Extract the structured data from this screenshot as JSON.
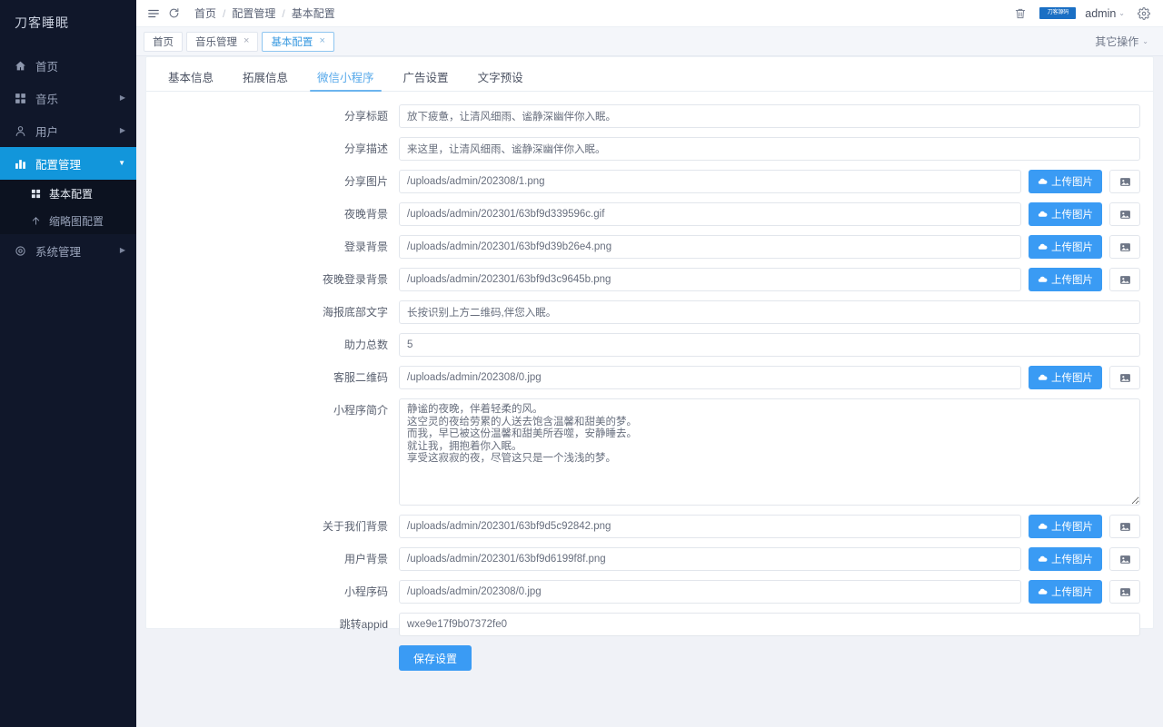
{
  "sidebar": {
    "brand": "刀客睡眠",
    "items": [
      {
        "label": "首页",
        "icon": "home-icon",
        "arrow": "",
        "active": false
      },
      {
        "label": "音乐",
        "icon": "grid-icon",
        "arrow": "▶",
        "active": false
      },
      {
        "label": "用户",
        "icon": "user-icon",
        "arrow": "▶",
        "active": false
      },
      {
        "label": "配置管理",
        "icon": "chart-icon",
        "arrow": "▼",
        "active": true
      },
      {
        "label": "系统管理",
        "icon": "gear-icon",
        "arrow": "▶",
        "active": false
      }
    ],
    "subitems": [
      {
        "label": "基本配置",
        "icon": "grid-icon",
        "selected": true
      },
      {
        "label": "缩略图配置",
        "icon": "upload-icon",
        "selected": false
      }
    ]
  },
  "topbar": {
    "menu_icon": "list-icon",
    "refresh_icon": "refresh-icon",
    "breadcrumb": [
      "首页",
      "配置管理",
      "基本配置"
    ],
    "breadcrumb_sep": "/",
    "trash_icon": "trash-icon",
    "logo_text": "刀客源码",
    "user": "admin",
    "user_caret": "⌄",
    "settings_icon": "gear-icon"
  },
  "tabstrip": {
    "tabs": [
      {
        "label": "首页",
        "closable": false,
        "active": false
      },
      {
        "label": "音乐管理",
        "closable": true,
        "active": false
      },
      {
        "label": "基本配置",
        "closable": true,
        "active": true
      }
    ],
    "close_glyph": "×",
    "other_ops": "其它操作",
    "other_ops_caret": "⌄"
  },
  "content_tabs": [
    {
      "label": "基本信息",
      "active": false
    },
    {
      "label": "拓展信息",
      "active": false
    },
    {
      "label": "微信小程序",
      "active": true
    },
    {
      "label": "广告设置",
      "active": false
    },
    {
      "label": "文字预设",
      "active": false
    }
  ],
  "form": {
    "upload_label": "上传图片",
    "upload_icon": "cloud-upload-icon",
    "picker_icon": "image-icon",
    "save_label": "保存设置",
    "fields": [
      {
        "label": "分享标题",
        "value": "放下疲惫，让清风细雨、谧静深幽伴你入眠。",
        "type": "text",
        "upload": false
      },
      {
        "label": "分享描述",
        "value": "来这里，让清风细雨、谧静深幽伴你入眠。",
        "type": "text",
        "upload": false
      },
      {
        "label": "分享图片",
        "value": "/uploads/admin/202308/1.png",
        "type": "text",
        "upload": true
      },
      {
        "label": "夜晚背景",
        "value": "/uploads/admin/202301/63bf9d339596c.gif",
        "type": "text",
        "upload": true
      },
      {
        "label": "登录背景",
        "value": "/uploads/admin/202301/63bf9d39b26e4.png",
        "type": "text",
        "upload": true
      },
      {
        "label": "夜晚登录背景",
        "value": "/uploads/admin/202301/63bf9d3c9645b.png",
        "type": "text",
        "upload": true
      },
      {
        "label": "海报底部文字",
        "value": "长按识别上方二维码,伴您入眠。",
        "type": "text",
        "upload": false
      },
      {
        "label": "助力总数",
        "value": "5",
        "type": "text",
        "upload": false
      },
      {
        "label": "客服二维码",
        "value": "/uploads/admin/202308/0.jpg",
        "type": "text",
        "upload": true
      },
      {
        "label": "小程序简介",
        "value": "静谧的夜晚，伴着轻柔的风。\n这空灵的夜给劳累的人送去饱含温馨和甜美的梦。\n而我，早已被这份温馨和甜美所吞噬，安静睡去。\n就让我，拥抱着你入眠。\n享受这寂寂的夜，尽管这只是一个浅浅的梦。",
        "type": "textarea",
        "upload": false
      },
      {
        "label": "关于我们背景",
        "value": "/uploads/admin/202301/63bf9d5c92842.png",
        "type": "text",
        "upload": true
      },
      {
        "label": "用户背景",
        "value": "/uploads/admin/202301/63bf9d6199f8f.png",
        "type": "text",
        "upload": true
      },
      {
        "label": "小程序码",
        "value": "/uploads/admin/202308/0.jpg",
        "type": "text",
        "upload": true
      },
      {
        "label": "跳转appid",
        "value": "wxe9e17f9b07372fe0",
        "type": "text",
        "upload": false
      }
    ]
  },
  "colors": {
    "sidebar_bg": "#10172a",
    "sidebar_active": "#1296db",
    "accent": "#3a9bf4",
    "tab_active": "#57a9ea",
    "page_bg": "#f0f2f7"
  }
}
